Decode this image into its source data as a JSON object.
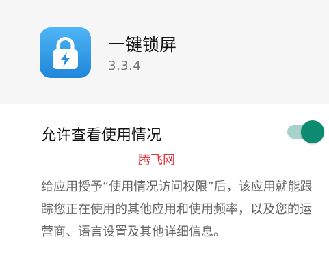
{
  "app": {
    "name": "一键锁屏",
    "version": "3.3.4",
    "icon": "lock-lightning-icon"
  },
  "setting": {
    "title": "允许查看使用情况",
    "toggle_on": true,
    "watermark": "腾飞网",
    "description": "给应用授予“使用情况访问权限”后，该应用就能跟踪您正在使用的其他应用和使用频率，以及您的运营商、语言设置及其他详细信息。"
  },
  "colors": {
    "header_bg": "#f6f6f6",
    "icon_gradient_top": "#4fb5f5",
    "icon_gradient_bottom": "#1f86da",
    "toggle_knob": "#0d8a72",
    "toggle_track": "#a7d1c9",
    "watermark": "#e0353a"
  }
}
